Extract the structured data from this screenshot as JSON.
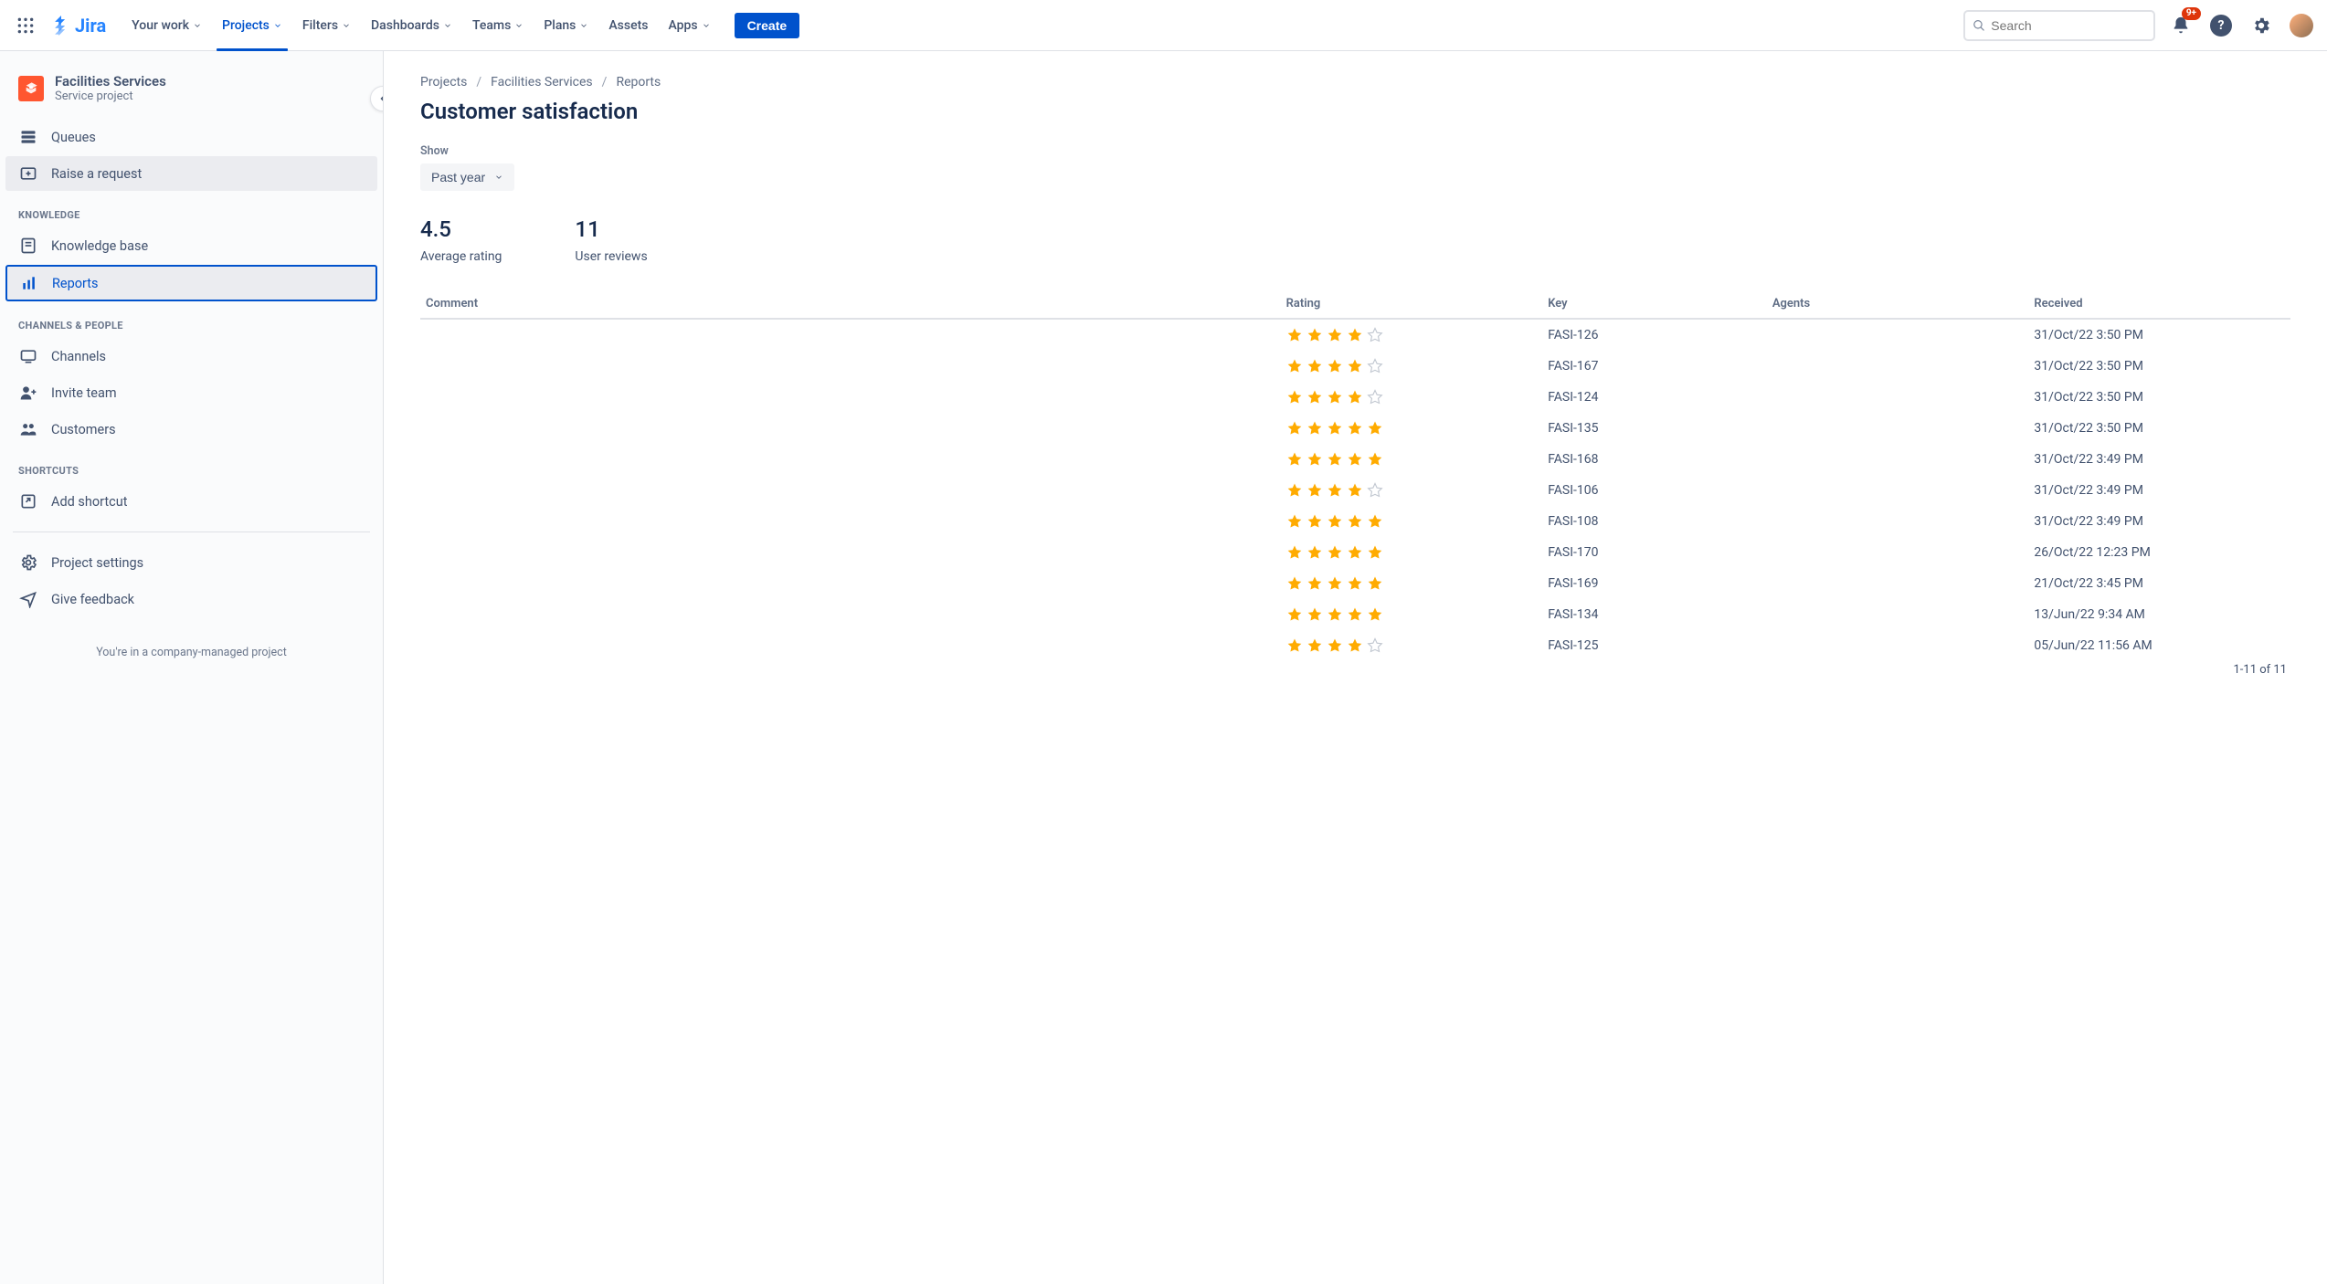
{
  "topnav": {
    "product": "Jira",
    "items": [
      {
        "label": "Your work",
        "dropdown": true
      },
      {
        "label": "Projects",
        "dropdown": true,
        "active": true
      },
      {
        "label": "Filters",
        "dropdown": true
      },
      {
        "label": "Dashboards",
        "dropdown": true
      },
      {
        "label": "Teams",
        "dropdown": true
      },
      {
        "label": "Plans",
        "dropdown": true
      },
      {
        "label": "Assets",
        "dropdown": false
      },
      {
        "label": "Apps",
        "dropdown": true
      }
    ],
    "create_label": "Create",
    "search_placeholder": "Search",
    "notification_badge": "9+"
  },
  "sidebar": {
    "project_name": "Facilities Services",
    "project_type": "Service project",
    "items_top": [
      {
        "icon": "queues",
        "label": "Queues"
      },
      {
        "icon": "raise",
        "label": "Raise a request",
        "selected_grey": true
      }
    ],
    "section_knowledge": "KNOWLEDGE",
    "items_knowledge": [
      {
        "icon": "kb",
        "label": "Knowledge base"
      },
      {
        "icon": "reports",
        "label": "Reports",
        "selected_blue": true
      }
    ],
    "section_channels": "CHANNELS & PEOPLE",
    "items_channels": [
      {
        "icon": "channels",
        "label": "Channels"
      },
      {
        "icon": "invite",
        "label": "Invite team"
      },
      {
        "icon": "customers",
        "label": "Customers"
      }
    ],
    "section_shortcuts": "SHORTCUTS",
    "items_shortcuts": [
      {
        "icon": "addshortcut",
        "label": "Add shortcut"
      }
    ],
    "items_bottom": [
      {
        "icon": "settings",
        "label": "Project settings"
      },
      {
        "icon": "feedback",
        "label": "Give feedback"
      }
    ],
    "footer": "You're in a company-managed project"
  },
  "main": {
    "breadcrumbs": [
      "Projects",
      "Facilities Services",
      "Reports"
    ],
    "page_title": "Customer satisfaction",
    "show_label": "Show",
    "timeframe": "Past year",
    "avg_rating": "4.5",
    "avg_rating_label": "Average rating",
    "review_count": "11",
    "review_count_label": "User reviews",
    "columns": {
      "comment": "Comment",
      "rating": "Rating",
      "key": "Key",
      "agents": "Agents",
      "received": "Received"
    },
    "rows": [
      {
        "comment": "",
        "rating": 4,
        "key": "FASI-126",
        "agents": "",
        "received": "31/Oct/22 3:50 PM"
      },
      {
        "comment": "",
        "rating": 4,
        "key": "FASI-167",
        "agents": "",
        "received": "31/Oct/22 3:50 PM"
      },
      {
        "comment": "",
        "rating": 4,
        "key": "FASI-124",
        "agents": "",
        "received": "31/Oct/22 3:50 PM"
      },
      {
        "comment": "",
        "rating": 5,
        "key": "FASI-135",
        "agents": "",
        "received": "31/Oct/22 3:50 PM"
      },
      {
        "comment": "",
        "rating": 5,
        "key": "FASI-168",
        "agents": "",
        "received": "31/Oct/22 3:49 PM"
      },
      {
        "comment": "",
        "rating": 4,
        "key": "FASI-106",
        "agents": "",
        "received": "31/Oct/22 3:49 PM"
      },
      {
        "comment": "",
        "rating": 5,
        "key": "FASI-108",
        "agents": "",
        "received": "31/Oct/22 3:49 PM"
      },
      {
        "comment": "",
        "rating": 5,
        "key": "FASI-170",
        "agents": "",
        "received": "26/Oct/22 12:23 PM"
      },
      {
        "comment": "",
        "rating": 5,
        "key": "FASI-169",
        "agents": "",
        "received": "21/Oct/22 3:45 PM"
      },
      {
        "comment": "",
        "rating": 5,
        "key": "FASI-134",
        "agents": "",
        "received": "13/Jun/22 9:34 AM"
      },
      {
        "comment": "",
        "rating": 4,
        "key": "FASI-125",
        "agents": "",
        "received": "05/Jun/22 11:56 AM"
      }
    ],
    "pager": "1-11 of 11"
  }
}
